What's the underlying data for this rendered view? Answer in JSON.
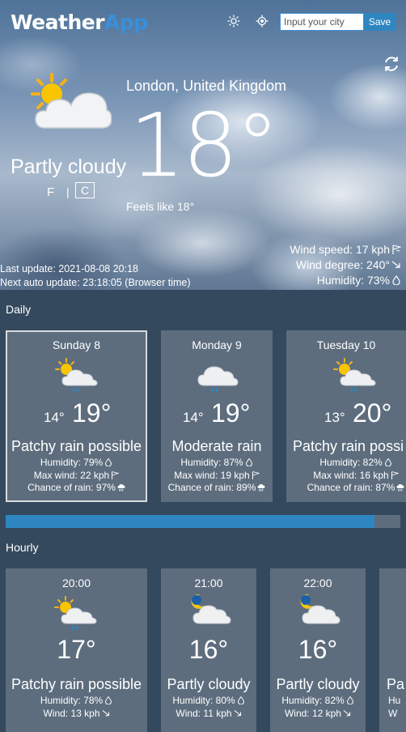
{
  "header": {
    "logo_part1": "Weather",
    "logo_part2": "App",
    "city_placeholder": "Input your city",
    "save_label": "Save"
  },
  "current": {
    "location": "London, United Kingdom",
    "temperature": "18°",
    "condition": "Partly cloudy",
    "unit_f": "F",
    "unit_separator": "|",
    "unit_c": "C",
    "feels_like": "Feels like 18°",
    "wind_speed": "Wind speed: 17 kph",
    "wind_degree": "Wind degree: 240°",
    "humidity": "Humidity: 73%",
    "last_update": "Last update: 2021-08-08 20:18",
    "next_update": "Next auto update: 23:18:05 (Browser time)"
  },
  "daily": {
    "label": "Daily",
    "progress": 0.935,
    "days": [
      {
        "title": "Sunday 8",
        "min": "14°",
        "max": "19°",
        "desc": "Patchy rain possible",
        "humidity": "Humidity: 79%",
        "wind": "Max wind: 22 kph",
        "rain": "Chance of rain: 97%",
        "icon": "sun-cloud-rain-icon"
      },
      {
        "title": "Monday 9",
        "min": "14°",
        "max": "19°",
        "desc": "Moderate rain",
        "humidity": "Humidity: 87%",
        "wind": "Max wind: 19 kph",
        "rain": "Chance of rain: 89%",
        "icon": "cloud-rain-icon"
      },
      {
        "title": "Tuesday 10",
        "min": "13°",
        "max": "20°",
        "desc": "Patchy rain possi",
        "humidity": "Humidity: 82%",
        "wind": "Max wind: 16 kph",
        "rain": "Chance of rain: 87%",
        "icon": "sun-cloud-rain-icon"
      }
    ]
  },
  "hourly": {
    "label": "Hourly",
    "hours": [
      {
        "time": "20:00",
        "temp": "17°",
        "desc": "Patchy rain possible",
        "humidity": "Humidity: 78%",
        "wind": "Wind: 13 kph",
        "icon": "sun-cloud-rain-icon"
      },
      {
        "time": "21:00",
        "temp": "16°",
        "desc": "Partly cloudy",
        "humidity": "Humidity: 80%",
        "wind": "Wind: 11 kph",
        "icon": "moon-cloud-icon"
      },
      {
        "time": "22:00",
        "temp": "16°",
        "desc": "Partly cloudy",
        "humidity": "Humidity: 82%",
        "wind": "Wind: 12 kph",
        "icon": "moon-cloud-icon"
      },
      {
        "desc": "Pa",
        "humidity": "Hu",
        "wind": "W"
      }
    ]
  },
  "colors": {
    "accent": "#2e86c1",
    "card": "#5d6d7e",
    "background": "#34495e"
  }
}
